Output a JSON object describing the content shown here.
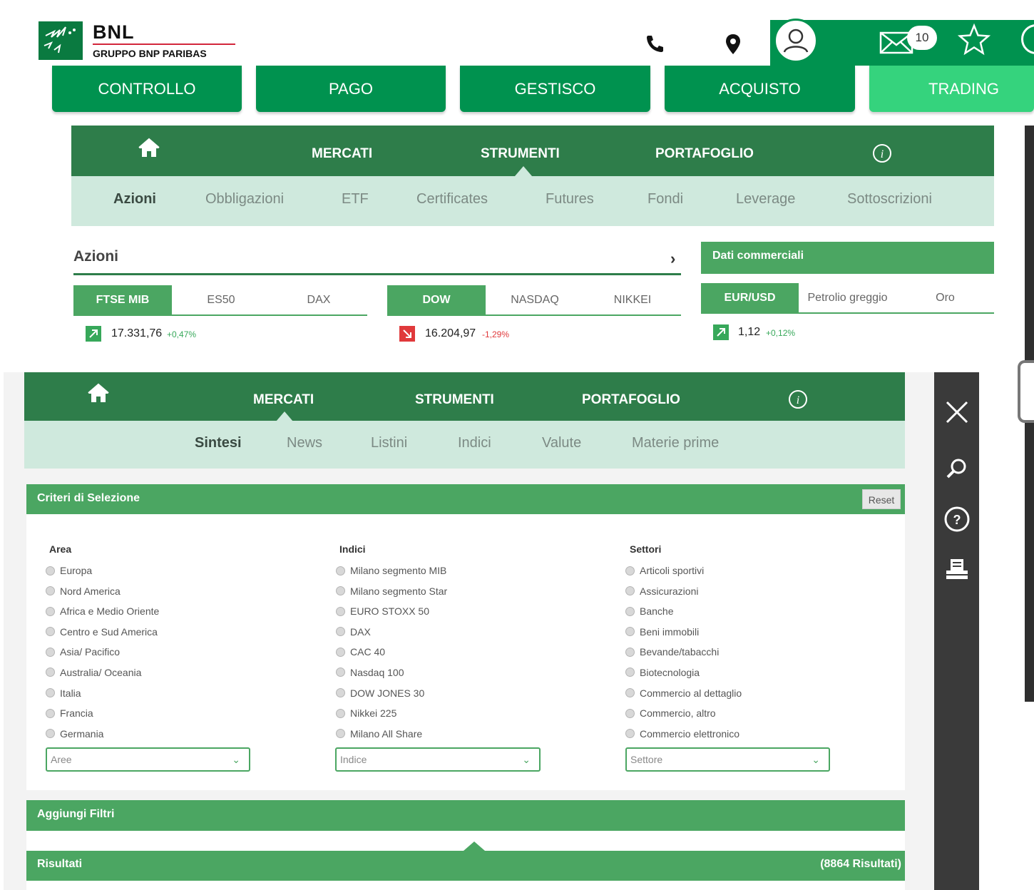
{
  "brand": {
    "name": "BNL",
    "subtitle": "GRUPPO BNP PARIBAS"
  },
  "header": {
    "icons": [
      "phone-icon",
      "location-pin-icon",
      "user-icon",
      "mail-icon",
      "star-icon"
    ],
    "mail_count": "10"
  },
  "main_tabs": [
    {
      "label": "CONTROLLO",
      "active": false
    },
    {
      "label": "PAGO",
      "active": false
    },
    {
      "label": "GESTISCO",
      "active": false
    },
    {
      "label": "ACQUISTO",
      "active": false
    },
    {
      "label": "TRADING",
      "active": true
    }
  ],
  "upper": {
    "nav": {
      "home_icon": "home-icon",
      "items": [
        "MERCATI",
        "STRUMENTI",
        "PORTAFOGLIO"
      ],
      "active": "STRUMENTI",
      "info_icon": "info-icon"
    },
    "sub_nav": [
      "Azioni",
      "Obbligazioni",
      "ETF",
      "Certificates",
      "Futures",
      "Fondi",
      "Leverage",
      "Sottoscrizioni"
    ],
    "sub_active": "Azioni",
    "azioni": {
      "title": "Azioni",
      "group1": {
        "tabs": [
          "FTSE MIB",
          "ES50",
          "DAX"
        ],
        "active": "FTSE MIB",
        "value": "17.331,76",
        "change": "+0,47%",
        "direction": "up"
      },
      "group2": {
        "tabs": [
          "DOW",
          "NASDAQ",
          "NIKKEI"
        ],
        "active": "DOW",
        "value": "16.204,97",
        "change": "-1,29%",
        "direction": "down"
      }
    },
    "dati_commerciali": {
      "title": "Dati commerciali",
      "tabs": [
        "EUR/USD",
        "Petrolio greggio",
        "Oro"
      ],
      "active": "EUR/USD",
      "value": "1,12",
      "change": "+0,12%",
      "direction": "up"
    }
  },
  "lower": {
    "nav": {
      "home_icon": "home-icon",
      "items": [
        "MERCATI",
        "STRUMENTI",
        "PORTAFOGLIO"
      ],
      "active": "MERCATI",
      "info_icon": "info-icon"
    },
    "sub_nav": [
      "Sintesi",
      "News",
      "Listini",
      "Indici",
      "Valute",
      "Materie prime"
    ],
    "sub_active": "Sintesi",
    "criteri": {
      "title": "Criteri di Selezione",
      "reset_label": "Reset",
      "columns": [
        {
          "title": "Area",
          "options": [
            "Europa",
            "Nord America",
            "Africa e Medio Oriente",
            "Centro e Sud America",
            "Asia/ Pacifico",
            "Australia/ Oceania",
            "Italia",
            "Francia",
            "Germania"
          ],
          "select_placeholder": "Aree"
        },
        {
          "title": "Indici",
          "options": [
            "Milano segmento MIB",
            "Milano segmento Star",
            "EURO STOXX 50",
            "DAX",
            "CAC 40",
            "Nasdaq 100",
            "DOW JONES 30",
            "Nikkei 225",
            "Milano All Share"
          ],
          "select_placeholder": "Indice"
        },
        {
          "title": "Settori",
          "options": [
            "Articoli sportivi",
            "Assicurazioni",
            "Banche",
            "Beni immobili",
            "Bevande/tabacchi",
            "Biotecnologia",
            "Commercio al dettaglio",
            "Commercio, altro",
            "Commercio elettronico"
          ],
          "select_placeholder": "Settore"
        }
      ]
    },
    "aggiungi_filtri": "Aggiungi Filtri",
    "risultati": {
      "title": "Risultati",
      "count": "(8864 Risultati)"
    },
    "toolbar_icons": [
      "close-icon",
      "search-icon",
      "help-icon",
      "print-icon"
    ]
  },
  "colors": {
    "primary_green": "#00924f",
    "dark_green": "#2e7d4a",
    "light_green": "#4ba662",
    "active_tab": "#35d37d",
    "pale_green": "#cfe9dd",
    "up": "#37a85a",
    "down": "#e0393b"
  }
}
